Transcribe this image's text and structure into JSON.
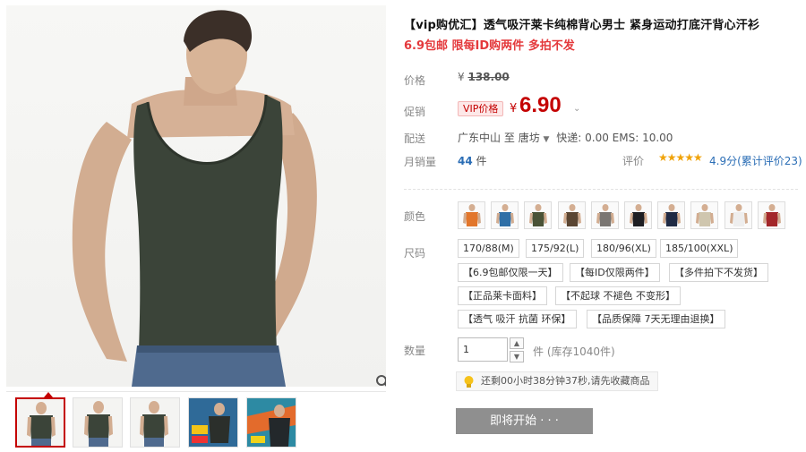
{
  "product": {
    "title": "【vip购优汇】透气吸汗莱卡纯棉背心男士 紧身运动打底汗背心汗衫",
    "subtitle": "6.9包邮 限每ID购两件 多拍不发"
  },
  "labels": {
    "price": "价格",
    "promo": "促销",
    "shipping": "配送",
    "monthly_sales": "月销量",
    "rating": "评价",
    "color": "颜色",
    "size": "尺码",
    "quantity": "数量"
  },
  "pricing": {
    "currency": "¥",
    "original": "138.00",
    "vip_badge": "VIP价格",
    "promo": "6.90"
  },
  "shipping": {
    "from": "广东中山",
    "to_word": "至",
    "to": "唐坊",
    "info": "快递: 0.00 EMS: 10.00"
  },
  "sales": {
    "count": "44",
    "unit": "件"
  },
  "rating": {
    "stars": "★★★★★",
    "score": "4.9分",
    "link": "(累计评价23)"
  },
  "colors": [
    {
      "name": "orange",
      "hex": "#e2762b"
    },
    {
      "name": "blue",
      "hex": "#2f6fa6"
    },
    {
      "name": "army-green",
      "hex": "#4a5236"
    },
    {
      "name": "brown",
      "hex": "#5a4532"
    },
    {
      "name": "grey",
      "hex": "#7a7672"
    },
    {
      "name": "black",
      "hex": "#1e1e22"
    },
    {
      "name": "navy",
      "hex": "#1f2a44"
    },
    {
      "name": "khaki",
      "hex": "#cfc6ae"
    },
    {
      "name": "white",
      "hex": "#eeeeee"
    },
    {
      "name": "red",
      "hex": "#a3272a"
    }
  ],
  "sizes": [
    "170/88(M)",
    "175/92(L)",
    "180/96(XL)",
    "185/100(XXL)"
  ],
  "tags": [
    "【6.9包邮仅限一天】",
    "【每ID仅限两件】",
    "【多件拍下不发货】",
    "【正品莱卡面料】",
    "【不起球 不褪色 不变形】",
    "【透气 吸汗 抗菌 环保】",
    "【品质保障 7天无理由退换】"
  ],
  "quantity": {
    "value": "1",
    "stock": "件 (库存1040件)"
  },
  "tip": "还剩00小时38分钟37秒,请先收藏商品",
  "buy_button": "即将开始 · · ·",
  "icons": {
    "zoom": "magnifier-icon",
    "tip": "lightbulb-icon"
  }
}
